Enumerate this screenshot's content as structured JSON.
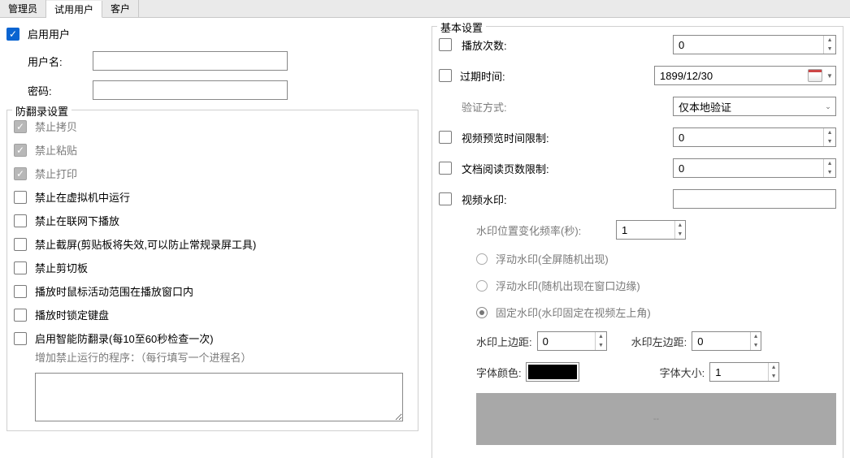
{
  "tabs": [
    "管理员",
    "试用用户",
    "客户"
  ],
  "left": {
    "enable_user": "启用用户",
    "username_label": "用户名:",
    "password_label": "密码:",
    "username_value": "",
    "password_value": "",
    "anti_group": "防翻录设置",
    "items": {
      "no_copy": "禁止拷贝",
      "no_paste": "禁止粘贴",
      "no_print": "禁止打印",
      "no_vm": "禁止在虚拟机中运行",
      "no_offline_net": "禁止在联网下播放",
      "no_screenshot": "禁止截屏(剪贴板将失效,可以防止常规录屏工具)",
      "no_clipboard": "禁止剪切板",
      "mouse_bound": "播放时鼠标活动范围在播放窗口内",
      "lock_keyboard": "播放时锁定键盘",
      "smart_anti": "启用智能防翻录(每10至60秒检查一次)",
      "add_proc_hint": "增加禁止运行的程序：（每行填写一个进程名）"
    }
  },
  "right": {
    "group": "基本设置",
    "play_count": "播放次数:",
    "play_count_val": "0",
    "expire_time": "过期时间:",
    "expire_time_val": "1899/12/30",
    "verify_method": "验证方式:",
    "verify_method_val": "仅本地验证",
    "preview_limit": "视频预览时间限制:",
    "preview_limit_val": "0",
    "doc_pages": "文档阅读页数限制:",
    "doc_pages_val": "0",
    "video_wm": "视频水印:",
    "video_wm_val": "",
    "wm_freq_label": "水印位置变化频率(秒):",
    "wm_freq_val": "1",
    "radio_float_full": "浮动水印(全屏随机出现)",
    "radio_float_edge": "浮动水印(随机出现在窗口边缘)",
    "radio_fixed": "固定水印(水印固定在视频左上角)",
    "wm_top": "水印上边距:",
    "wm_top_val": "0",
    "wm_left": "水印左边距:",
    "wm_left_val": "0",
    "font_color": "字体颜色:",
    "font_color_val": "#000000",
    "font_size": "字体大小:",
    "font_size_val": "1",
    "preview_text": "--"
  }
}
